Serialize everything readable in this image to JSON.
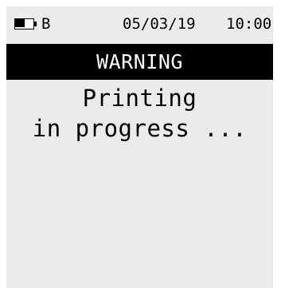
{
  "status_bar": {
    "battery_icon": "battery-half-icon",
    "battery_label": "B",
    "date": "05/03/19",
    "time": "10:00"
  },
  "dialog": {
    "title": "WARNING",
    "message_line_1": "Printing",
    "message_line_2": "in progress ..."
  },
  "colors": {
    "screen_background": "#ebebeb",
    "title_bar_background": "#000000",
    "title_text": "#ffffff",
    "text": "#000000"
  }
}
